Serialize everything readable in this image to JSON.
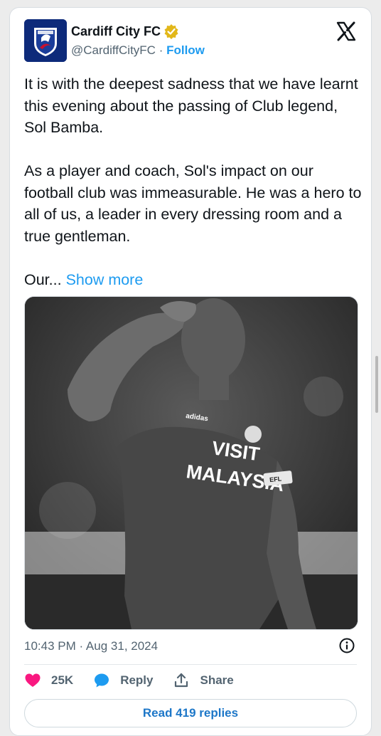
{
  "account": {
    "name": "Cardiff City FC",
    "handle": "@CardiffCityFC",
    "separator": " · ",
    "follow_label": "Follow"
  },
  "tweet": {
    "paragraph1": "It is with the deepest sadness that we have learnt this evening about the passing of Club legend, Sol Bamba.",
    "paragraph2": "As a player and coach, Sol's impact on our football club was immeasurable. He was a hero to all of us, a leader in every dressing room and a true gentleman.",
    "paragraph3_truncated": "Our...",
    "show_more_label": "Show more"
  },
  "media": {
    "shirt_text_line1": "VISIT",
    "shirt_text_line2": "MALAYSIA",
    "brand_text": "adidas",
    "armband_text": "EFL"
  },
  "timestamp": "10:43 PM · Aug 31, 2024",
  "actions": {
    "like_count": "25K",
    "reply_label": "Reply",
    "share_label": "Share"
  },
  "read_replies_label": "Read 419 replies",
  "colors": {
    "accent_blue": "#1d9bf0",
    "like_pink": "#f91880",
    "verified_gold": "#e2b719",
    "club_blue": "#0d2a7a"
  },
  "icons": [
    "verified-badge-icon",
    "x-logo-icon",
    "info-icon",
    "heart-icon",
    "reply-bubble-icon",
    "share-icon"
  ]
}
